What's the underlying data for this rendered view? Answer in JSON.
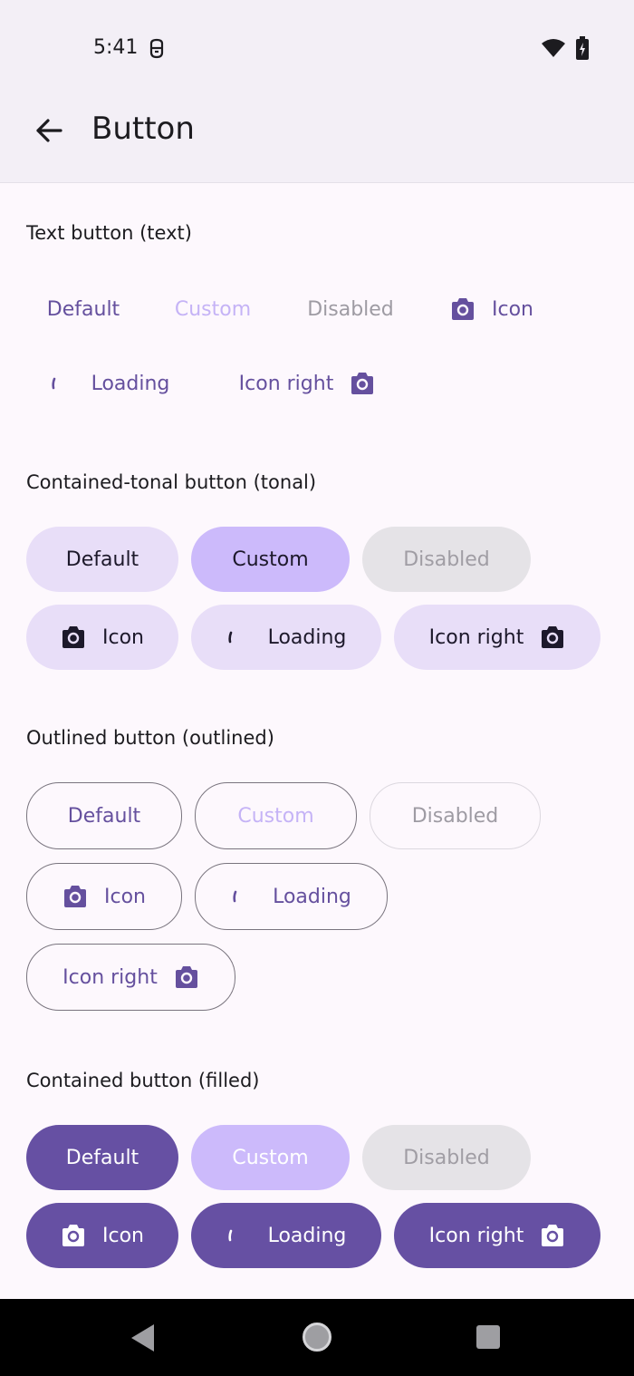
{
  "status": {
    "time": "5:41"
  },
  "app_bar": {
    "title": "Button"
  },
  "sections": {
    "text": {
      "title": "Text button (text)",
      "default": "Default",
      "custom": "Custom",
      "disabled": "Disabled",
      "icon": "Icon",
      "loading": "Loading",
      "icon_right": "Icon right"
    },
    "tonal": {
      "title": "Contained-tonal button (tonal)",
      "default": "Default",
      "custom": "Custom",
      "disabled": "Disabled",
      "icon": "Icon",
      "loading": "Loading",
      "icon_right": "Icon right"
    },
    "outlined": {
      "title": "Outlined button (outlined)",
      "default": "Default",
      "custom": "Custom",
      "disabled": "Disabled",
      "icon": "Icon",
      "loading": "Loading",
      "icon_right": "Icon right"
    },
    "filled": {
      "title": "Contained button (filled)",
      "default": "Default",
      "custom": "Custom",
      "disabled": "Disabled",
      "icon": "Icon",
      "loading": "Loading",
      "icon_right": "Icon right"
    }
  },
  "icons": {
    "back": "arrow-back-icon",
    "camera": "camera-icon",
    "spinner": "loading-spinner-icon",
    "wifi": "wifi-icon",
    "battery": "battery-charging-icon",
    "notification": "notification-icon"
  },
  "colors": {
    "primary": "#6650a3",
    "tonal_container": "#e8def8",
    "custom": "#ccbafb",
    "disabled_container": "#e5e3e7",
    "background": "#fdf8fd",
    "app_bar": "#f3eff6"
  }
}
